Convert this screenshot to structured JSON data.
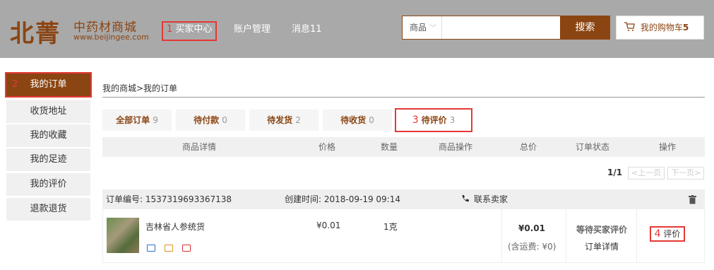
{
  "header": {
    "logo_main": "北菁",
    "logo_cn": "中药材商城",
    "logo_url": "www.beijingee.com",
    "nav": [
      {
        "num": "1",
        "label": "买家中心"
      },
      {
        "label": "账户管理"
      },
      {
        "label": "消息11"
      }
    ],
    "search": {
      "category": "商品",
      "button": "搜索"
    },
    "cart": {
      "label": "我的购物车",
      "count": "5"
    }
  },
  "sidebar": {
    "items": [
      {
        "num": "2",
        "label": "我的订单"
      },
      {
        "label": "收货地址"
      },
      {
        "label": "我的收藏"
      },
      {
        "label": "我的足迹"
      },
      {
        "label": "我的评价"
      },
      {
        "label": "退款退货"
      }
    ]
  },
  "breadcrumb": "我的商城>我的订单",
  "tabs": [
    {
      "label": "全部订单",
      "count": "9"
    },
    {
      "label": "待付款",
      "count": "0"
    },
    {
      "label": "待发货",
      "count": "2"
    },
    {
      "label": "待收货",
      "count": "0"
    },
    {
      "num": "3",
      "label": "待评价",
      "count": "3"
    }
  ],
  "table_headers": [
    "商品详情",
    "价格",
    "数量",
    "商品操作",
    "总价",
    "订单状态",
    "操作"
  ],
  "pager": {
    "current": "1/1",
    "prev": "<上一页",
    "next": "下一页>"
  },
  "order": {
    "number_label": "订单编号: 1537319693367138",
    "created_label": "创建时间: 2018-09-19 09:14",
    "contact": "联系卖家",
    "product_name": "吉林省人参统货",
    "price": "¥0.01",
    "qty": "1克",
    "total": "¥0.01",
    "shipping": "(含运费: ¥0)",
    "status": "等待买家评价",
    "detail_link": "订单详情",
    "action_num": "4",
    "action": "评价"
  },
  "colors": {
    "brand": "#8b4513",
    "header_bg": "#a9a9a9",
    "highlight": "#e53935"
  }
}
